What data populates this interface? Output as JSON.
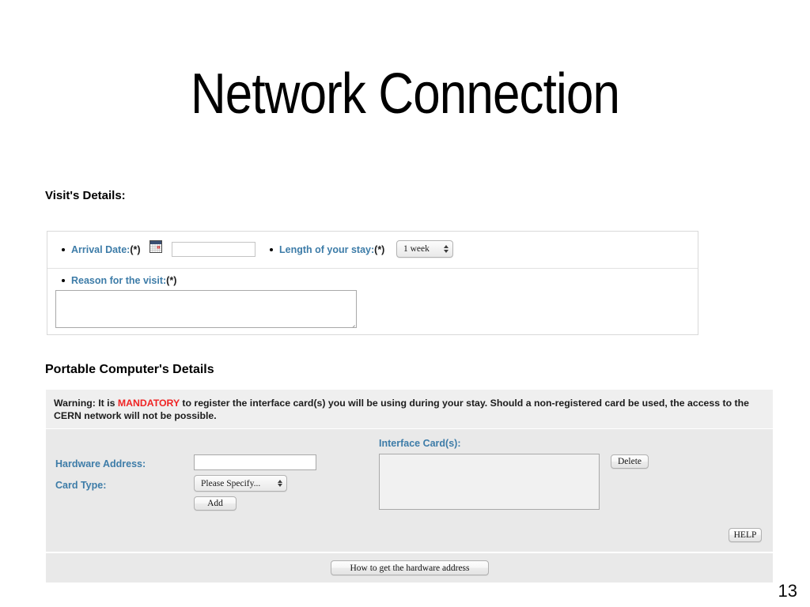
{
  "slide": {
    "title": "Network Connection",
    "page_number": "13"
  },
  "visit_section": {
    "heading": "Visit's Details:",
    "arrival": {
      "label": "Arrival Date:",
      "required_marker": "(*)",
      "icon": "calendar-icon",
      "input_value": "",
      "input_placeholder": ""
    },
    "length_of_stay": {
      "label": "Length of your stay:",
      "required_marker": "(*)",
      "selected": "1 week"
    },
    "reason": {
      "label": "Reason for the visit:",
      "required_marker": "(*)",
      "value": "",
      "placeholder": ""
    }
  },
  "portable_section": {
    "heading": "Portable Computer's Details",
    "warning": {
      "prefix": "Warning: It is ",
      "emphasis": "MANDATORY",
      "suffix": " to register the interface card(s) you will be using during your stay. Should a non-registered card be used, the access to the CERN network will not be possible.",
      "emphasis_color": "#ef2424"
    },
    "hardware_address": {
      "label": "Hardware Address:",
      "value": "",
      "placeholder": ""
    },
    "card_type": {
      "label": "Card Type:",
      "selected": "Please Specify..."
    },
    "add_button": "Add",
    "interface_cards": {
      "label": "Interface Card(s):",
      "items": []
    },
    "delete_button": "Delete",
    "help_button": "HELP",
    "howto_button": "How to get the hardware address"
  },
  "colors": {
    "label_blue": "#3d7ca8",
    "warning_red": "#ef2424",
    "panel_gray": "#e9e9e9",
    "warning_gray": "#efefef"
  }
}
